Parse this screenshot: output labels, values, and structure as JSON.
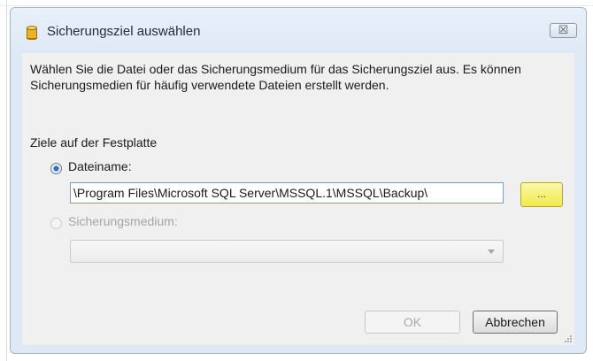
{
  "dialog": {
    "title": "Sicherungsziel auswählen",
    "close_label": "☒",
    "description": "Wählen Sie die Datei oder das Sicherungsmedium für das Sicherungsziel aus. Es können Sicherungsmedien für häufig verwendete Dateien erstellt werden.",
    "group_label": "Ziele auf der Festplatte",
    "options": {
      "file": {
        "label": "Dateiname:",
        "checked": true,
        "enabled": true
      },
      "device": {
        "label": "Sicherungsmedium:",
        "checked": false,
        "enabled": false
      }
    },
    "file_path": "\\Program Files\\Microsoft SQL Server\\MSSQL.1\\MSSQL\\Backup\\",
    "browse_label": "...",
    "device_select_value": "",
    "buttons": {
      "ok": "OK",
      "cancel": "Abbrechen"
    }
  },
  "colors": {
    "frame": "#dfe9f5",
    "client": "#f0f0f0",
    "browse_highlight": "#f1ea4a",
    "radio_selected": "#2d6ec8"
  },
  "icons": {
    "title": "database-cylinder-icon",
    "close": "close-icon",
    "combo": "chevron-down-icon",
    "grip": "resize-grip-icon"
  }
}
